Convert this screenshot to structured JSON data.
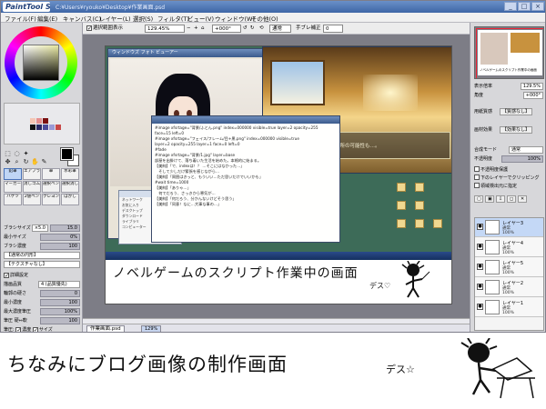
{
  "app": {
    "logo": "PaintTool SAI",
    "path": "C:¥Users¥ryouko¥Desktop¥作業画面.psd",
    "window_buttons": [
      "_",
      "□",
      "×"
    ]
  },
  "menu": [
    "ファイル(F)",
    "編集(E)",
    "キャンバス(C)",
    "レイヤー(L)",
    "選択(S)",
    "フィルタ(T)",
    "ビュー(V)",
    "ウィンドウ(W)",
    "その他(O)"
  ],
  "toolbar": {
    "selection_show_label": "選択範囲表示",
    "selection_show_checked": true,
    "zoom": "129.45%",
    "rotation": "+000°",
    "blend_mode": "通常",
    "stabilizer_label": "手ブレ補正",
    "stabilizer_value": "0"
  },
  "tools": {
    "grid": [
      {
        "name": "鉛筆",
        "selected": true
      },
      {
        "name": "エアブラシ"
      },
      {
        "name": "筆"
      },
      {
        "name": "水彩筆"
      },
      {
        "name": "マーカー"
      },
      {
        "name": "消しゴム"
      },
      {
        "name": "選択ペン"
      },
      {
        "name": "選択消し"
      },
      {
        "name": "バケツ"
      },
      {
        "name": "2値ペン"
      },
      {
        "name": "クレヨン"
      },
      {
        "name": "ぼかし"
      }
    ],
    "brush": {
      "size_label": "ブラシサイズ",
      "size_mult": "×5.0",
      "size_value": "15.0",
      "min_size_label": "最小サイズ",
      "min_size_value": "0%",
      "density_label": "ブラシ濃度",
      "density_value": "100",
      "shape_value": "【通常の円形】",
      "texture_value": "【テクスチャなし】",
      "detail_label": "詳細設定",
      "quality_label": "描画品質",
      "quality_value": "4 (品質優先)",
      "edge_label": "輪郭の硬さ",
      "edge_value": "0",
      "min_density_label": "最小濃度",
      "min_density_value": "100",
      "max_pressure_label": "最大濃度筆圧",
      "max_pressure_value": "100%",
      "pressure_label": "筆圧 硬⇔軟",
      "pressure_value": "100",
      "pressure_opts_label": "筆圧:",
      "density_chk_label": "濃度",
      "size_chk_label": "サイズ"
    }
  },
  "canvas": {
    "inner_window_title": "ウィンドウズ フォト ビューアー",
    "inner_message": "番所の可能性も…。",
    "text_lines": [
      "#image xfsrtage=\"背景/ふとん.png\" index=000000 visible=true layer=2 opacity=255",
      "face=15 left=0",
      "",
      "#image xfsrtage=\"フェイス/フレーム/目+黒.png\" index=000000 visible=true",
      "layer=2 opacity=255 layer=1 face=0 left=0",
      "",
      "#fade",
      "#image xfsrtage=\"背景/1.jpg\" layer=base",
      "部屋を出掛けて、落ち着いた生活を始めた。本格的に始まる。",
      "【美純】「で、indexは！？ …そこにはなかった…」",
      "　そして少しだけ緊張を感じながら…",
      "【美純】「周囲はきっと、もういい…ただ思いだけでいいかも」",
      "",
      "#wait time=1000",
      "【美純】「ありゃ…」",
      "　何でだろう、さっきから寒気が…",
      "【美純】「何だろう、分かんないけどそう思う」",
      "",
      "【美純】「同意！なに…大事な事の…」"
    ],
    "explorer_items": [
      "ネットワーク",
      "お気に入り",
      "デスクトップ",
      "ダウンロード",
      "ライブラリ",
      "コンピューター"
    ],
    "caption": "ノベルゲームのスクリプト作業中の画面",
    "caption_sub": "デス♡",
    "status_tab": "作業画面.psd",
    "status_zoom": "129%"
  },
  "right": {
    "zoom_label": "表示倍率",
    "zoom_value": "129.5%",
    "angle_label": "角度",
    "angle_value": "+000°",
    "paper_label": "用紙質感",
    "paper_value": "【質感なし】",
    "effect_label": "画材効果",
    "effect_value": "【効果なし】",
    "blend_label": "合成モード",
    "blend_value": "通常",
    "opacity_label": "不透明度",
    "opacity_value": "100%",
    "checks": [
      "不透明度保護",
      "下のレイヤーでクリッピング",
      "領域検出元に指定"
    ],
    "layers": [
      {
        "name": "レイヤー3",
        "mode": "通常",
        "opacity": "100%",
        "selected": true
      },
      {
        "name": "レイヤー4",
        "mode": "通常",
        "opacity": "100%"
      },
      {
        "name": "レイヤー5",
        "mode": "通常",
        "opacity": "100%"
      },
      {
        "name": "レイヤー2",
        "mode": "通常",
        "opacity": "100%"
      },
      {
        "name": "レイヤー1",
        "mode": "通常",
        "opacity": "100%"
      }
    ]
  },
  "below": {
    "caption": "ちなみにブログ画像の制作画面",
    "caption_sub": "デス☆"
  }
}
